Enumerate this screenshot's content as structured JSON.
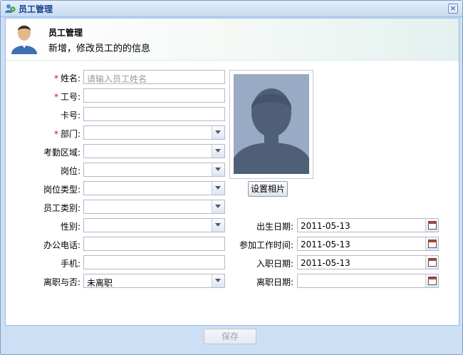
{
  "window": {
    "title": "员工管理",
    "close_symbol": "×"
  },
  "header": {
    "title": "员工管理",
    "subtitle": "新增，修改员工的的信息"
  },
  "required_mark": "*",
  "form": {
    "name": {
      "label": "姓名:",
      "placeholder": "请输入员工姓名",
      "required": true
    },
    "emp_no": {
      "label": "工号:",
      "value": "",
      "required": true
    },
    "card_no": {
      "label": "卡号:",
      "value": ""
    },
    "dept": {
      "label": "部门:",
      "value": "",
      "required": true
    },
    "area": {
      "label": "考勤区域:",
      "value": ""
    },
    "post": {
      "label": "岗位:",
      "value": ""
    },
    "post_type": {
      "label": "岗位类型:",
      "value": ""
    },
    "emp_type": {
      "label": "员工类别:",
      "value": ""
    },
    "gender": {
      "label": "性别:",
      "value": ""
    },
    "office_phone": {
      "label": "办公电话:",
      "value": ""
    },
    "mobile": {
      "label": "手机:",
      "value": ""
    },
    "resigned": {
      "label": "离职与否:",
      "value": "未离职"
    },
    "birth_date": {
      "label": "出生日期:",
      "value": "2011-05-13"
    },
    "work_date": {
      "label": "参加工作时间:",
      "value": "2011-05-13"
    },
    "join_date": {
      "label": "入职日期:",
      "value": "2011-05-13"
    },
    "leave_date": {
      "label": "离职日期:",
      "value": ""
    }
  },
  "photo": {
    "button_label": "设置相片"
  },
  "footer": {
    "save_label": "保存"
  },
  "colors": {
    "title": "#15428b",
    "required": "#ee0000",
    "photo_bg": "#98aac4"
  }
}
